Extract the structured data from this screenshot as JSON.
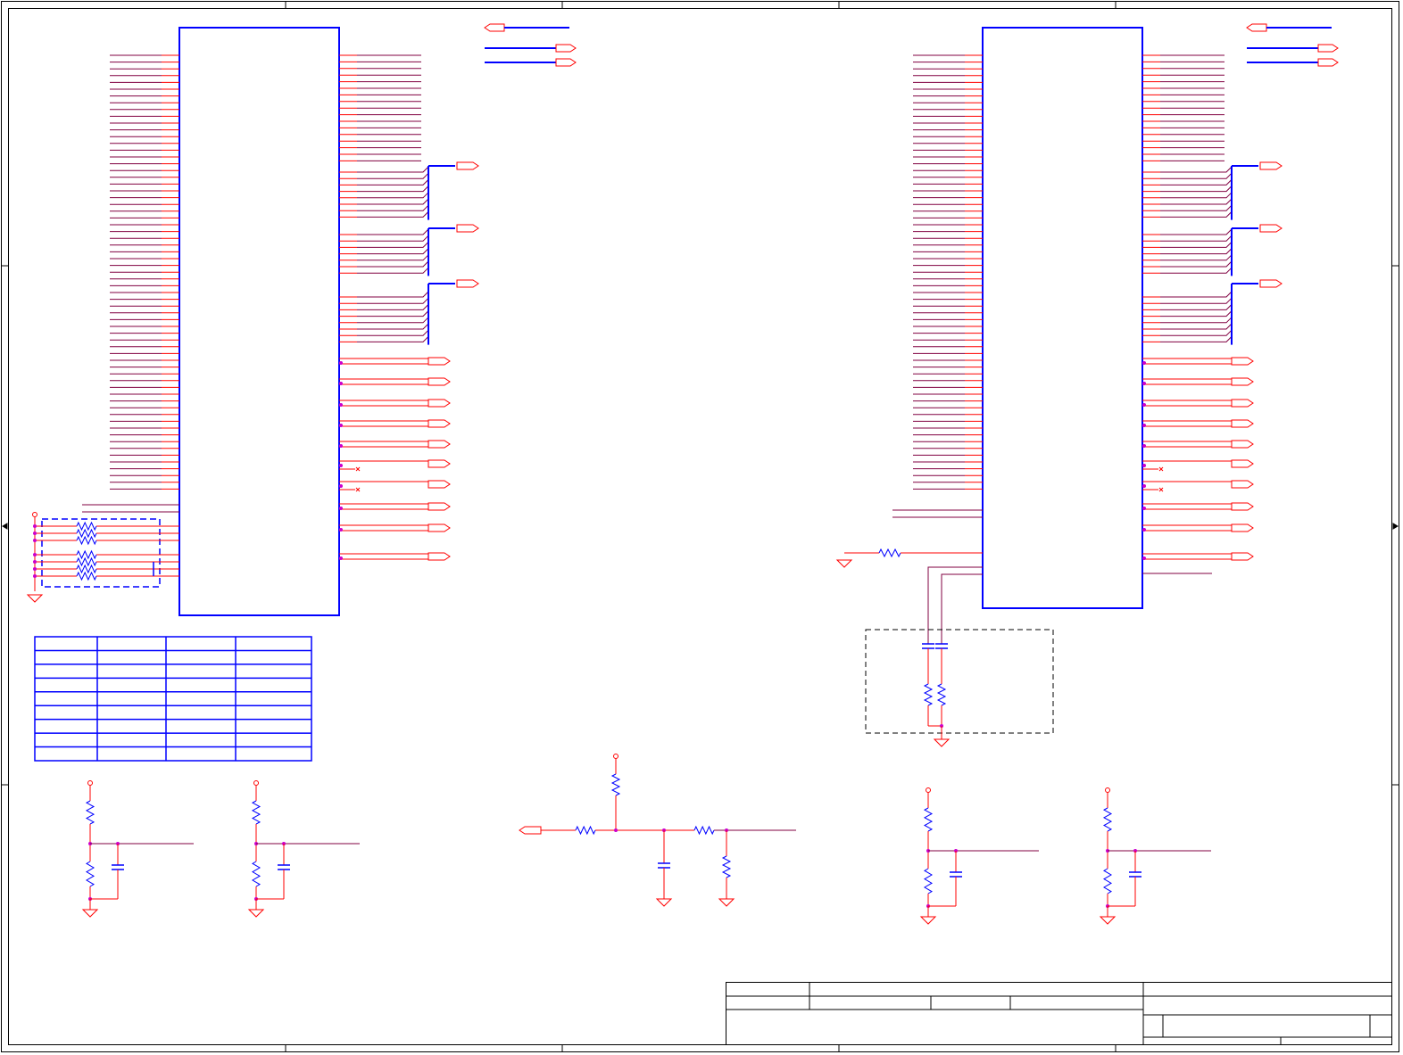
{
  "colors": {
    "wire": "#ff0000",
    "bus": "#0000ff",
    "net": "#800040",
    "component": "#0000ff",
    "junction": "#cc00cc",
    "border": "#000000",
    "dashed": "#000000"
  },
  "left_chip": {
    "left_pin_count": 65,
    "right_data_pins": 17,
    "bus_groups": 3,
    "ports": 10,
    "io_ports": 12
  },
  "right_chip": {
    "left_pin_count": 65,
    "right_data_pins": 17,
    "bus_groups": 3,
    "ports": 10,
    "io_ports": 12
  },
  "pin_table": {
    "rows": 9,
    "cols": 4
  },
  "icons": {
    "offpage_connector": "offpage-connector-icon",
    "ground": "ground-icon",
    "power": "power-icon",
    "resistor": "resistor-icon",
    "capacitor": "capacitor-icon"
  }
}
